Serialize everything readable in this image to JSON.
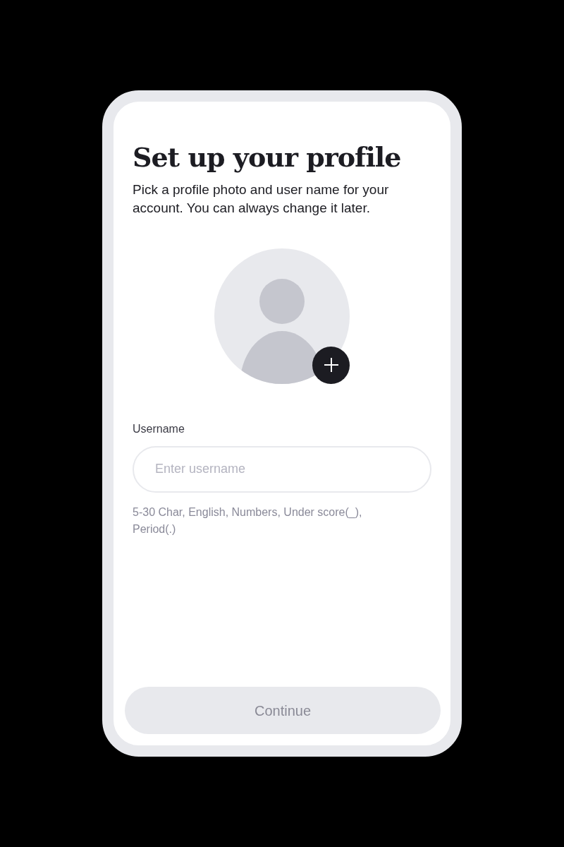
{
  "title": "Set up your profile",
  "subtitle": "Pick a profile photo and user name for your account. You can always change it later.",
  "username": {
    "label": "Username",
    "placeholder": "Enter username",
    "hint": "5-30 Char, English, Numbers, Under score(_), Period(.)"
  },
  "continue_button": {
    "label": "Continue",
    "disabled": true
  }
}
